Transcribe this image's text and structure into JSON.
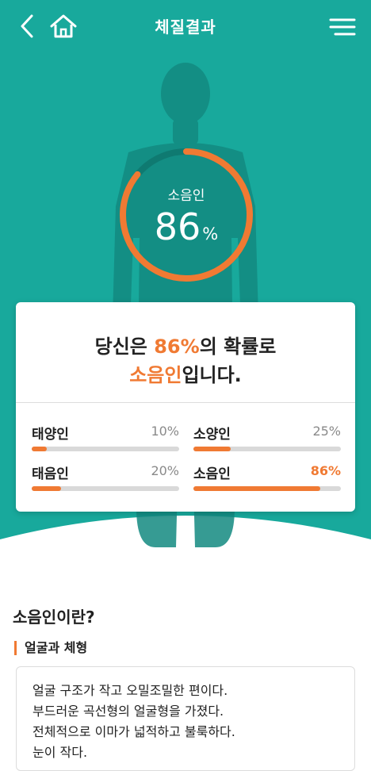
{
  "header": {
    "title": "체질결과",
    "back_icon": "back-chevron-icon",
    "home_icon": "home-icon",
    "menu_icon": "hamburger-menu-icon"
  },
  "colors": {
    "teal": "#18a99c",
    "teal_dark": "#138a80",
    "accent": "#f07a33",
    "track": "#d9d9d9"
  },
  "gauge": {
    "label": "소음인",
    "value": "86",
    "unit": "%",
    "fraction": 0.86
  },
  "summary": {
    "prefix": "당신은 ",
    "percent": "86%",
    "middle": "의 확률로",
    "type": "소음인",
    "suffix": "입니다."
  },
  "stats": [
    {
      "name": "태양인",
      "value": "10%",
      "fraction": 0.1
    },
    {
      "name": "소양인",
      "value": "25%",
      "fraction": 0.25
    },
    {
      "name": "태음인",
      "value": "20%",
      "fraction": 0.2
    },
    {
      "name": "소음인",
      "value": "86%",
      "fraction": 0.86
    }
  ],
  "section": {
    "title": "소음인이란?",
    "subtitle": "얼굴과 체형",
    "lines": [
      "얼굴 구조가 작고 오밀조밀한 편이다.",
      "부드러운 곡선형의 얼굴형을 가졌다.",
      "전체적으로 이마가 넓적하고 불룩하다.",
      "눈이 작다."
    ]
  }
}
